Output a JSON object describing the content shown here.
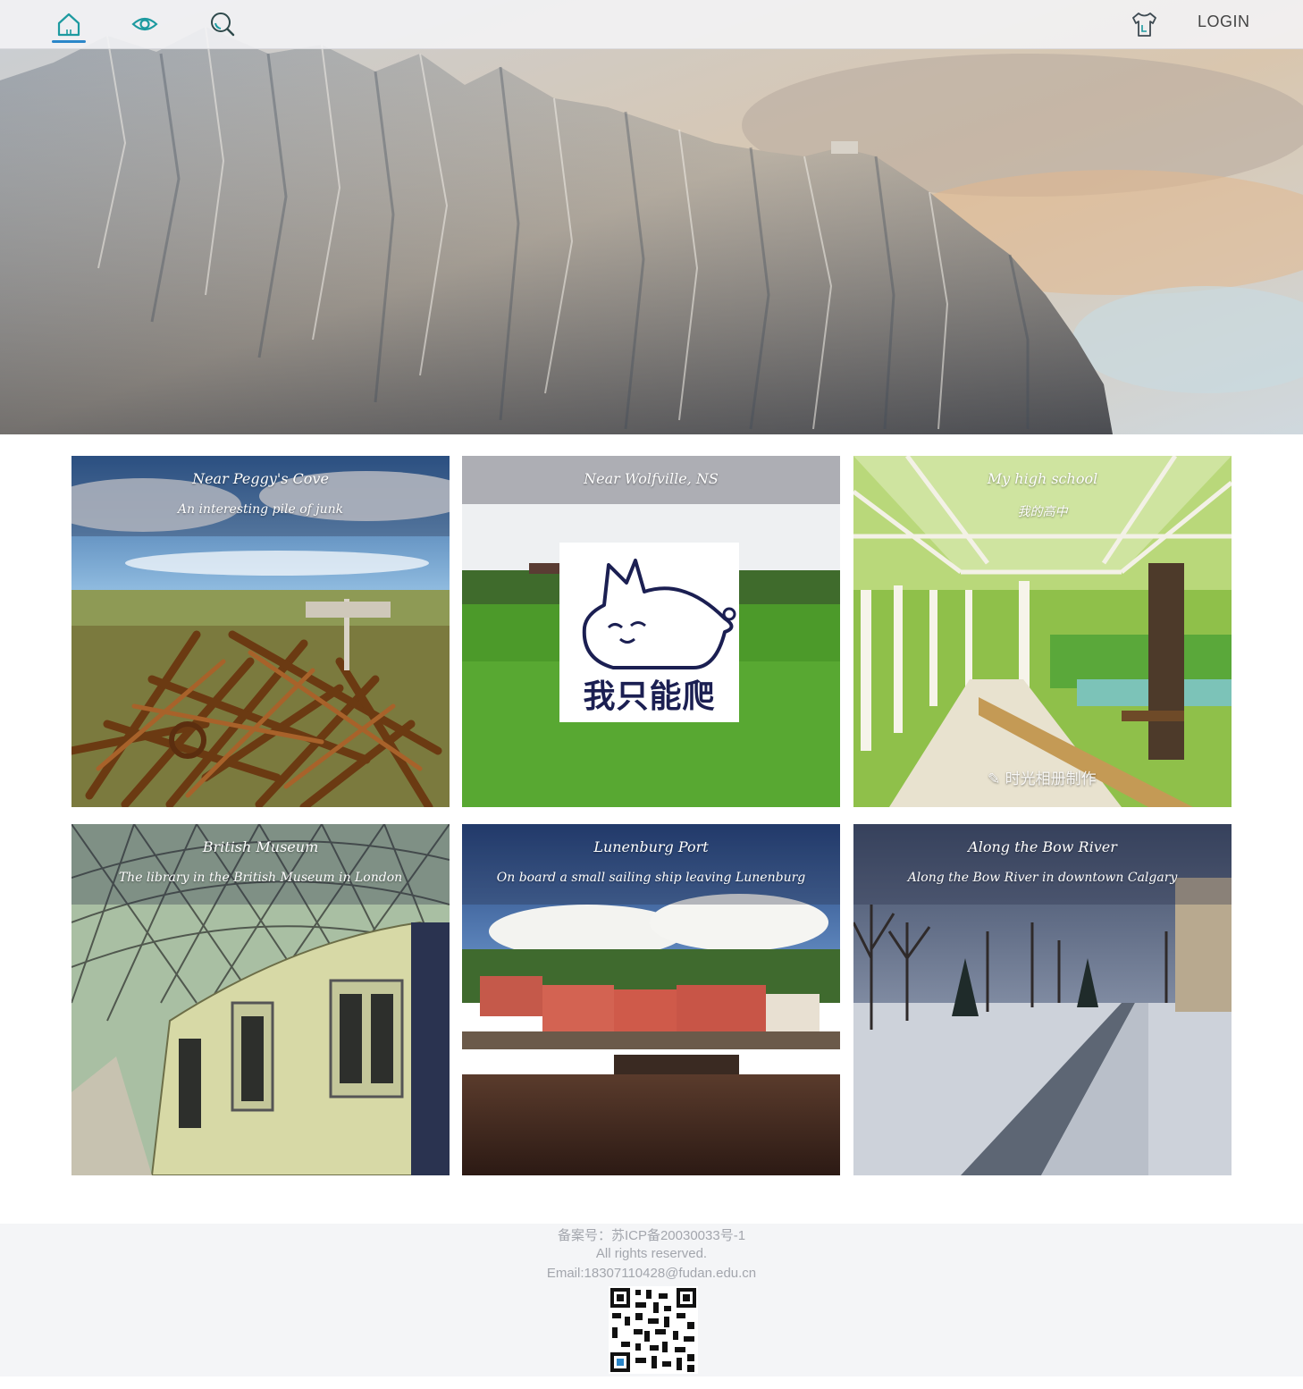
{
  "nav": {
    "icons": [
      "home-icon",
      "eye-icon",
      "search-icon",
      "tshirt-icon"
    ],
    "login_label": "LOGIN",
    "accent_color": "#2b86c9",
    "icon_color": "#1d9aa0"
  },
  "gallery": [
    {
      "title": "Near Peggy's Cove",
      "description": "An interesting pile of junk"
    },
    {
      "title": "Near Wolfville, NS",
      "description": "",
      "meme_text": "我只能爬"
    },
    {
      "title": "My high school",
      "description": "我的高中",
      "watermark": "时光相册制作"
    },
    {
      "title": "British Museum",
      "description": "The library in the British Museum in London"
    },
    {
      "title": "Lunenburg Port",
      "description": "On board a small sailing ship leaving Lunenburg"
    },
    {
      "title": "Along the Bow River",
      "description": "Along the Bow River in downtown Calgary"
    }
  ],
  "footer": {
    "icp": "备案号：苏ICP备20030033号-1",
    "rights": "All rights reserved.",
    "email": "Email:18307110428@fudan.edu.cn",
    "qr": "qr-code"
  }
}
